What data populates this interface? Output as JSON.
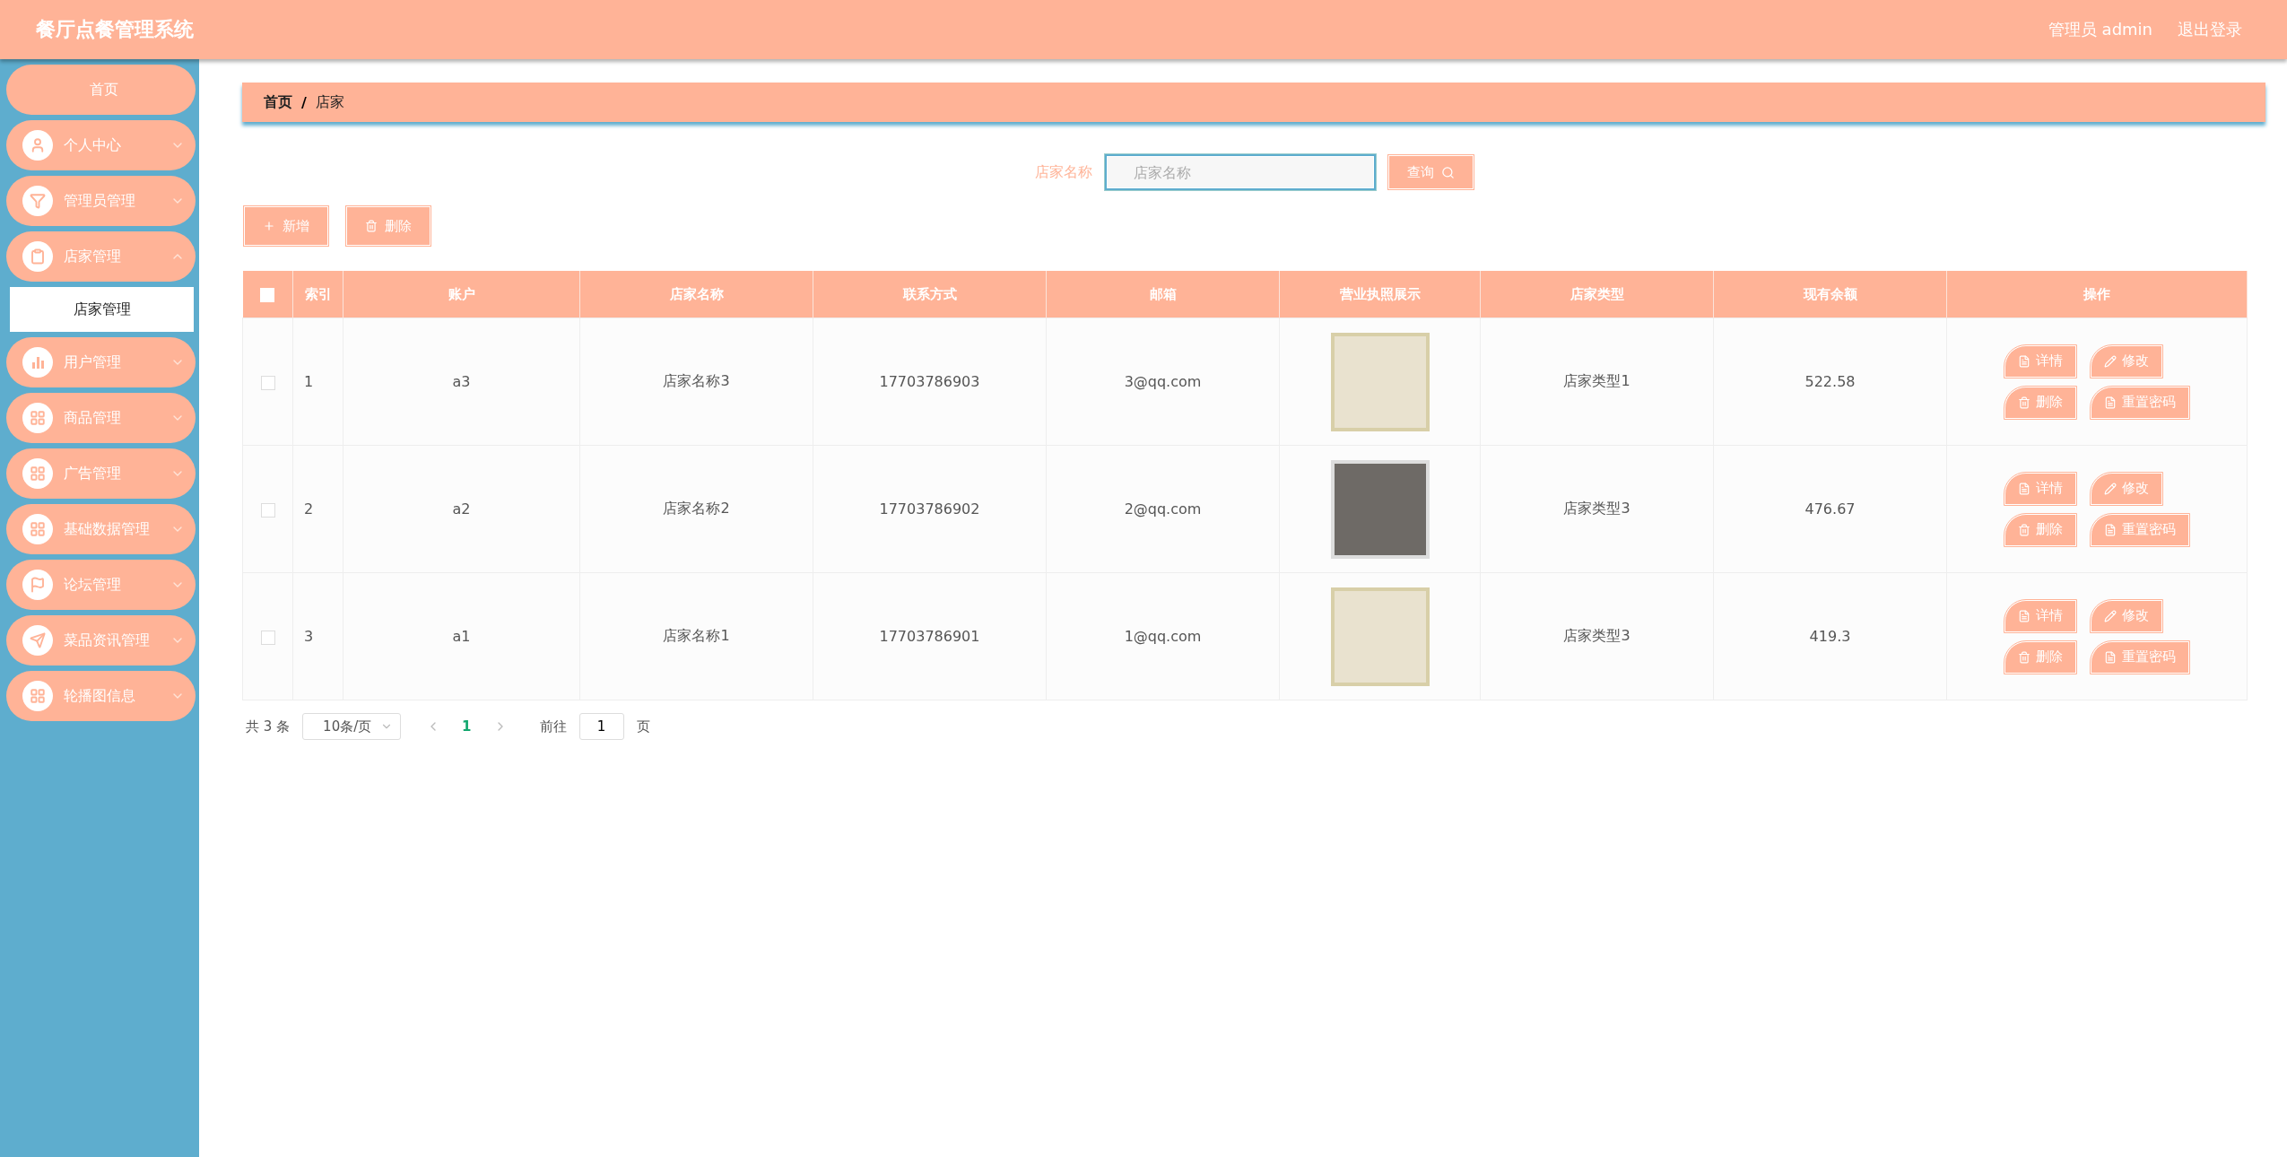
{
  "header": {
    "title": "餐厅点餐管理系统",
    "user": "管理员 admin",
    "logout": "退出登录"
  },
  "sidebar": {
    "items": [
      {
        "label": "首页"
      },
      {
        "label": "个人中心",
        "expanded": false
      },
      {
        "label": "管理员管理",
        "expanded": false
      },
      {
        "label": "店家管理",
        "expanded": true,
        "children": [
          {
            "label": "店家管理",
            "selected": true
          }
        ]
      },
      {
        "label": "用户管理",
        "expanded": false
      },
      {
        "label": "商品管理",
        "expanded": false
      },
      {
        "label": "广告管理",
        "expanded": false
      },
      {
        "label": "基础数据管理",
        "expanded": false
      },
      {
        "label": "论坛管理",
        "expanded": false
      },
      {
        "label": "菜品资讯管理",
        "expanded": false
      },
      {
        "label": "轮播图信息",
        "expanded": false
      }
    ]
  },
  "breadcrumb": [
    "首页",
    "店家"
  ],
  "breadcrumb_separator": "/",
  "search": {
    "label": "店家名称",
    "placeholder": "店家名称",
    "button": "查询"
  },
  "toolbar": [
    "新增",
    "删除"
  ],
  "table": {
    "select_all": {
      "checked": false
    },
    "columns": [
      "索引",
      "账户",
      "店家名称",
      "联系方式",
      "邮箱",
      "营业执照展示",
      "店家类型",
      "现有余额",
      "操作"
    ],
    "rows": [
      {
        "checked": false,
        "index": "1",
        "account": "a3",
        "name": "店家名称3",
        "phone": "17703786903",
        "email": "3@qq.com",
        "type": "店家类型1",
        "balance": "522.58",
        "actions": [
          "详情",
          "修改",
          "删除",
          "重置密码"
        ]
      },
      {
        "checked": false,
        "index": "2",
        "account": "a2",
        "name": "店家名称2",
        "phone": "17703786902",
        "email": "2@qq.com",
        "type": "店家类型3",
        "balance": "476.67",
        "actions": [
          "详情",
          "修改",
          "删除",
          "重置密码"
        ]
      },
      {
        "checked": false,
        "index": "3",
        "account": "a1",
        "name": "店家名称1",
        "phone": "17703786901",
        "email": "1@qq.com",
        "type": "店家类型3",
        "balance": "419.3",
        "actions": [
          "详情",
          "修改",
          "删除",
          "重置密码"
        ]
      }
    ]
  },
  "pagination": {
    "total": "共 3 条",
    "page_size": "10条/页",
    "pages": [
      {
        "label": "1",
        "selected": true
      }
    ],
    "jump_label": "前往",
    "jump_value": "1",
    "jump_suffix": "页"
  }
}
